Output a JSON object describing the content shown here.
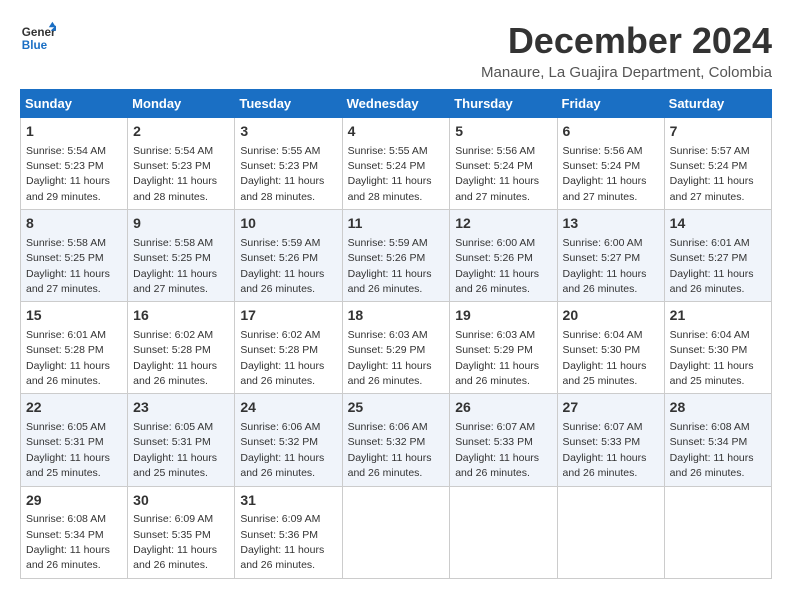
{
  "logo": {
    "line1": "General",
    "line2": "Blue"
  },
  "title": "December 2024",
  "location": "Manaure, La Guajira Department, Colombia",
  "days_of_week": [
    "Sunday",
    "Monday",
    "Tuesday",
    "Wednesday",
    "Thursday",
    "Friday",
    "Saturday"
  ],
  "weeks": [
    [
      {
        "day": "1",
        "sunrise": "5:54 AM",
        "sunset": "5:23 PM",
        "daylight": "11 hours and 29 minutes."
      },
      {
        "day": "2",
        "sunrise": "5:54 AM",
        "sunset": "5:23 PM",
        "daylight": "11 hours and 28 minutes."
      },
      {
        "day": "3",
        "sunrise": "5:55 AM",
        "sunset": "5:23 PM",
        "daylight": "11 hours and 28 minutes."
      },
      {
        "day": "4",
        "sunrise": "5:55 AM",
        "sunset": "5:24 PM",
        "daylight": "11 hours and 28 minutes."
      },
      {
        "day": "5",
        "sunrise": "5:56 AM",
        "sunset": "5:24 PM",
        "daylight": "11 hours and 27 minutes."
      },
      {
        "day": "6",
        "sunrise": "5:56 AM",
        "sunset": "5:24 PM",
        "daylight": "11 hours and 27 minutes."
      },
      {
        "day": "7",
        "sunrise": "5:57 AM",
        "sunset": "5:24 PM",
        "daylight": "11 hours and 27 minutes."
      }
    ],
    [
      {
        "day": "8",
        "sunrise": "5:58 AM",
        "sunset": "5:25 PM",
        "daylight": "11 hours and 27 minutes."
      },
      {
        "day": "9",
        "sunrise": "5:58 AM",
        "sunset": "5:25 PM",
        "daylight": "11 hours and 27 minutes."
      },
      {
        "day": "10",
        "sunrise": "5:59 AM",
        "sunset": "5:26 PM",
        "daylight": "11 hours and 26 minutes."
      },
      {
        "day": "11",
        "sunrise": "5:59 AM",
        "sunset": "5:26 PM",
        "daylight": "11 hours and 26 minutes."
      },
      {
        "day": "12",
        "sunrise": "6:00 AM",
        "sunset": "5:26 PM",
        "daylight": "11 hours and 26 minutes."
      },
      {
        "day": "13",
        "sunrise": "6:00 AM",
        "sunset": "5:27 PM",
        "daylight": "11 hours and 26 minutes."
      },
      {
        "day": "14",
        "sunrise": "6:01 AM",
        "sunset": "5:27 PM",
        "daylight": "11 hours and 26 minutes."
      }
    ],
    [
      {
        "day": "15",
        "sunrise": "6:01 AM",
        "sunset": "5:28 PM",
        "daylight": "11 hours and 26 minutes."
      },
      {
        "day": "16",
        "sunrise": "6:02 AM",
        "sunset": "5:28 PM",
        "daylight": "11 hours and 26 minutes."
      },
      {
        "day": "17",
        "sunrise": "6:02 AM",
        "sunset": "5:28 PM",
        "daylight": "11 hours and 26 minutes."
      },
      {
        "day": "18",
        "sunrise": "6:03 AM",
        "sunset": "5:29 PM",
        "daylight": "11 hours and 26 minutes."
      },
      {
        "day": "19",
        "sunrise": "6:03 AM",
        "sunset": "5:29 PM",
        "daylight": "11 hours and 26 minutes."
      },
      {
        "day": "20",
        "sunrise": "6:04 AM",
        "sunset": "5:30 PM",
        "daylight": "11 hours and 25 minutes."
      },
      {
        "day": "21",
        "sunrise": "6:04 AM",
        "sunset": "5:30 PM",
        "daylight": "11 hours and 25 minutes."
      }
    ],
    [
      {
        "day": "22",
        "sunrise": "6:05 AM",
        "sunset": "5:31 PM",
        "daylight": "11 hours and 25 minutes."
      },
      {
        "day": "23",
        "sunrise": "6:05 AM",
        "sunset": "5:31 PM",
        "daylight": "11 hours and 25 minutes."
      },
      {
        "day": "24",
        "sunrise": "6:06 AM",
        "sunset": "5:32 PM",
        "daylight": "11 hours and 26 minutes."
      },
      {
        "day": "25",
        "sunrise": "6:06 AM",
        "sunset": "5:32 PM",
        "daylight": "11 hours and 26 minutes."
      },
      {
        "day": "26",
        "sunrise": "6:07 AM",
        "sunset": "5:33 PM",
        "daylight": "11 hours and 26 minutes."
      },
      {
        "day": "27",
        "sunrise": "6:07 AM",
        "sunset": "5:33 PM",
        "daylight": "11 hours and 26 minutes."
      },
      {
        "day": "28",
        "sunrise": "6:08 AM",
        "sunset": "5:34 PM",
        "daylight": "11 hours and 26 minutes."
      }
    ],
    [
      {
        "day": "29",
        "sunrise": "6:08 AM",
        "sunset": "5:34 PM",
        "daylight": "11 hours and 26 minutes."
      },
      {
        "day": "30",
        "sunrise": "6:09 AM",
        "sunset": "5:35 PM",
        "daylight": "11 hours and 26 minutes."
      },
      {
        "day": "31",
        "sunrise": "6:09 AM",
        "sunset": "5:36 PM",
        "daylight": "11 hours and 26 minutes."
      },
      null,
      null,
      null,
      null
    ]
  ]
}
